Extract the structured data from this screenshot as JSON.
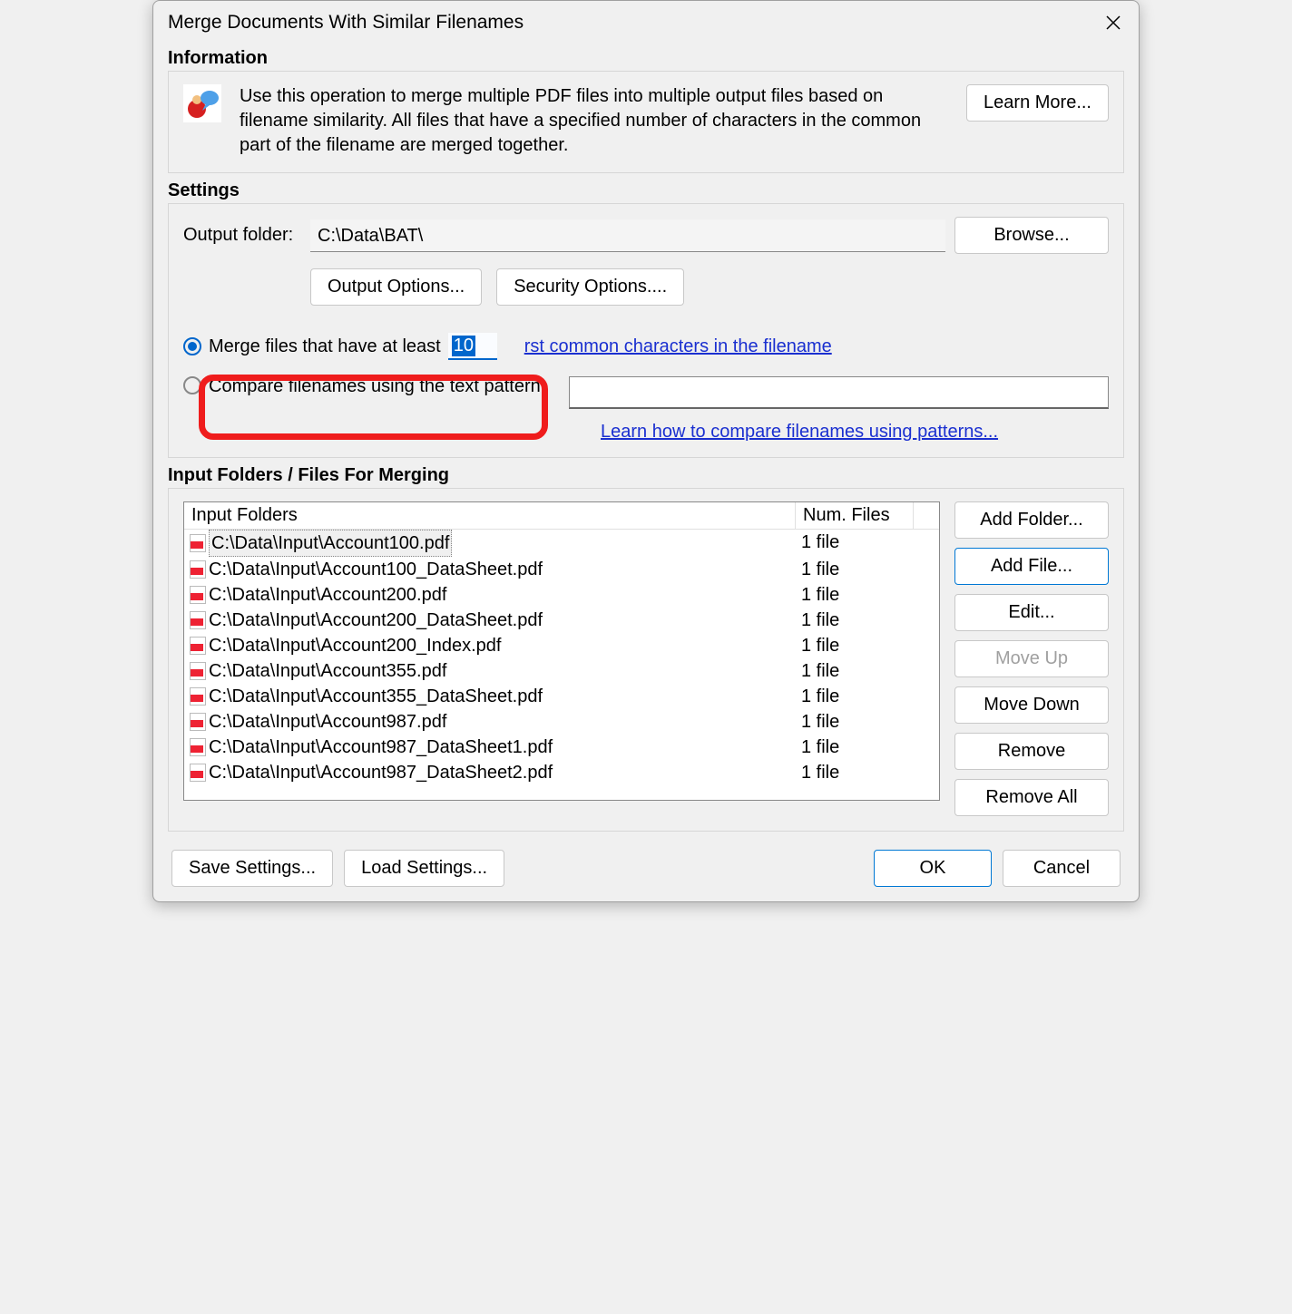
{
  "title": "Merge Documents With Similar Filenames",
  "info": {
    "heading": "Information",
    "text": "Use this operation to merge multiple PDF files into multiple output files based on filename similarity. All files that have a specified number of characters in the common part of the filename are merged together.",
    "learn_more": "Learn More..."
  },
  "settings": {
    "heading": "Settings",
    "output_label": "Output folder:",
    "output_path": "C:\\Data\\BAT\\",
    "browse": "Browse...",
    "output_options": "Output Options...",
    "security_options": "Security Options....",
    "merge_label_pre": "Merge files that have at least",
    "merge_count": "10",
    "merge_label_link": "rst common characters in the filename",
    "compare_label": "Compare filenames using the text pattern:",
    "learn_pattern": "Learn how to compare filenames using patterns..."
  },
  "input": {
    "heading": "Input Folders / Files For Merging",
    "col_folders": "Input Folders",
    "col_num": "Num. Files",
    "rows": [
      {
        "path": "C:\\Data\\Input\\Account100.pdf",
        "num": "1 file"
      },
      {
        "path": "C:\\Data\\Input\\Account100_DataSheet.pdf",
        "num": "1 file"
      },
      {
        "path": "C:\\Data\\Input\\Account200.pdf",
        "num": "1 file"
      },
      {
        "path": "C:\\Data\\Input\\Account200_DataSheet.pdf",
        "num": "1 file"
      },
      {
        "path": "C:\\Data\\Input\\Account200_Index.pdf",
        "num": "1 file"
      },
      {
        "path": "C:\\Data\\Input\\Account355.pdf",
        "num": "1 file"
      },
      {
        "path": "C:\\Data\\Input\\Account355_DataSheet.pdf",
        "num": "1 file"
      },
      {
        "path": "C:\\Data\\Input\\Account987.pdf",
        "num": "1 file"
      },
      {
        "path": "C:\\Data\\Input\\Account987_DataSheet1.pdf",
        "num": "1 file"
      },
      {
        "path": "C:\\Data\\Input\\Account987_DataSheet2.pdf",
        "num": "1 file"
      }
    ],
    "add_folder": "Add Folder...",
    "add_file": "Add File...",
    "edit": "Edit...",
    "move_up": "Move Up",
    "move_down": "Move Down",
    "remove": "Remove",
    "remove_all": "Remove All"
  },
  "footer": {
    "save": "Save Settings...",
    "load": "Load Settings...",
    "ok": "OK",
    "cancel": "Cancel"
  }
}
